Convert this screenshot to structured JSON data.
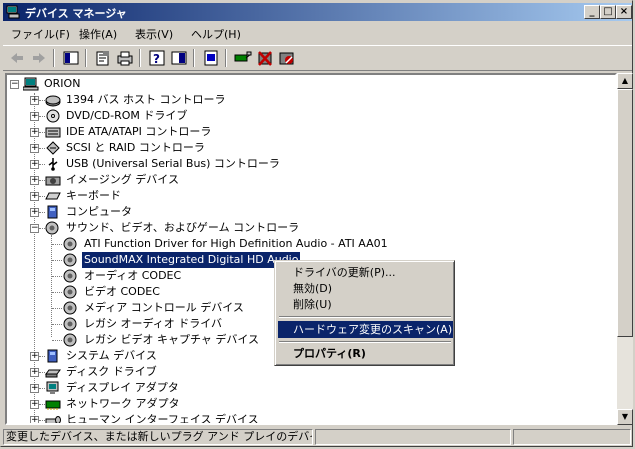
{
  "window": {
    "title": "デバイス マネージャ"
  },
  "titlebar_buttons": {
    "minimize": "_",
    "maximize": "□",
    "close": "×"
  },
  "menu": [
    {
      "label": "ファイル(F)"
    },
    {
      "label": "操作(A)"
    },
    {
      "label": "表示(V)"
    },
    {
      "label": "ヘルプ(H)"
    }
  ],
  "toolbar_icons": [
    "back-arrow-icon",
    "forward-arrow-icon",
    "show-hide-tree-icon",
    "properties-icon",
    "print-icon",
    "help-icon",
    "view-icon",
    "update-driver-icon",
    "scan-hardware-icon",
    "uninstall-icon",
    "disable-icon"
  ],
  "tree": {
    "root": "ORION",
    "categories": [
      {
        "label": "1394 バス ホスト コントローラ",
        "icon": "firewire-icon",
        "expanded": false
      },
      {
        "label": "DVD/CD-ROM ドライブ",
        "icon": "cdrom-icon",
        "expanded": false
      },
      {
        "label": "IDE ATA/ATAPI コントローラ",
        "icon": "ide-controller-icon",
        "expanded": false
      },
      {
        "label": "SCSI と RAID コントローラ",
        "icon": "scsi-icon",
        "expanded": false
      },
      {
        "label": "USB (Universal Serial Bus) コントローラ",
        "icon": "usb-icon",
        "expanded": false
      },
      {
        "label": "イメージング デバイス",
        "icon": "camera-icon",
        "expanded": false
      },
      {
        "label": "キーボード",
        "icon": "keyboard-icon",
        "expanded": false
      },
      {
        "label": "コンピュータ",
        "icon": "computer-icon",
        "expanded": false
      },
      {
        "label": "サウンド、ビデオ、およびゲーム コントローラ",
        "icon": "speaker-icon",
        "expanded": true
      },
      {
        "label": "システム デバイス",
        "icon": "system-icon",
        "expanded": false
      },
      {
        "label": "ディスク ドライブ",
        "icon": "disk-icon",
        "expanded": false
      },
      {
        "label": "ディスプレイ アダプタ",
        "icon": "display-icon",
        "expanded": false
      },
      {
        "label": "ネットワーク アダプタ",
        "icon": "network-icon",
        "expanded": false
      },
      {
        "label": "ヒューマン インターフェイス デバイス",
        "icon": "hid-icon",
        "expanded": false
      }
    ],
    "sound_children": [
      {
        "label": "ATI Function Driver for High Definition Audio - ATI AA01"
      },
      {
        "label": "SoundMAX Integrated Digital HD Audio",
        "selected": true
      },
      {
        "label": "オーディオ CODEC"
      },
      {
        "label": "ビデオ CODEC"
      },
      {
        "label": "メディア コントロール デバイス"
      },
      {
        "label": "レガシ オーディオ ドライバ"
      },
      {
        "label": "レガシ ビデオ キャプチャ デバイス"
      }
    ]
  },
  "context_menu": {
    "items": [
      {
        "label": "ドライバの更新(P)...",
        "highlighted": false
      },
      {
        "label": "無効(D)",
        "highlighted": false
      },
      {
        "label": "削除(U)",
        "highlighted": false
      },
      {
        "label": "ハードウェア変更のスキャン(A)",
        "highlighted": true
      },
      {
        "label": "プロパティ(R)",
        "highlighted": false,
        "bold": true
      }
    ]
  },
  "status": {
    "text": "変更したデバイス、または新しいプラグ アンド プレイのデバイスをスキャンします。"
  },
  "colors": {
    "selection": "#0a246a",
    "face": "#d4d0c8",
    "title_start": "#0a246a",
    "title_end": "#a6caf0"
  }
}
